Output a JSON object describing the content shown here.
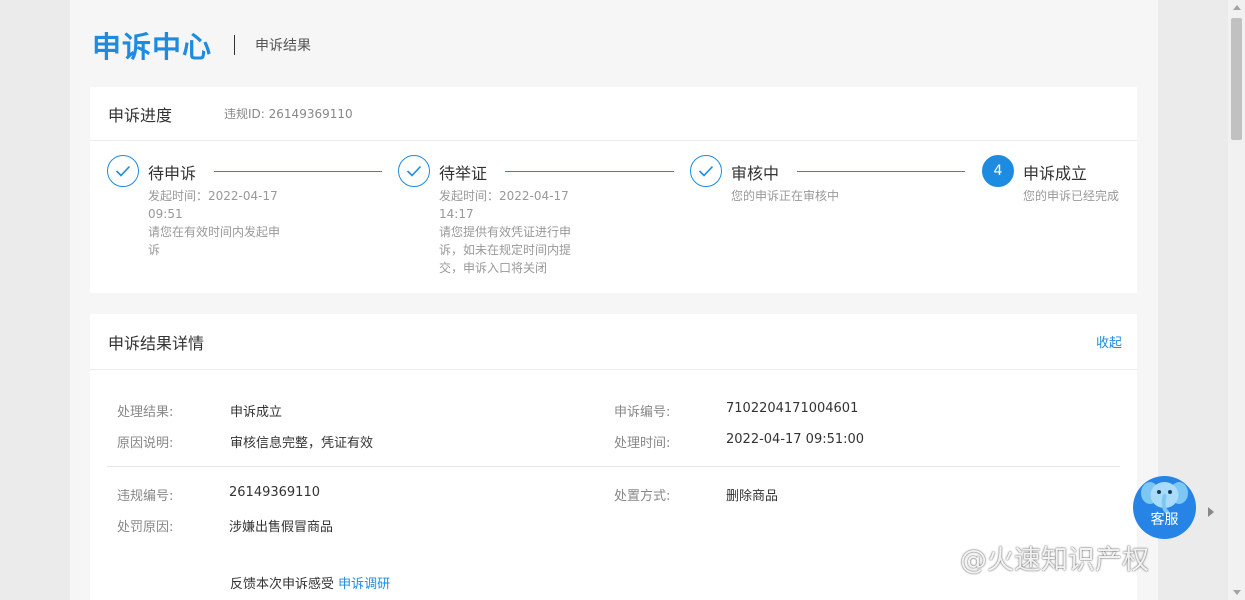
{
  "header": {
    "brand": "申诉中心",
    "subtitle": "申诉结果"
  },
  "progress": {
    "title": "申诉进度",
    "violation_id": "违规ID: 26149369110",
    "steps": [
      {
        "title": "待申诉",
        "desc": [
          "发起时间：2022-04-17",
          "09:51",
          "请您在有效时间内发起申",
          "诉"
        ],
        "status": "done"
      },
      {
        "title": "待举证",
        "desc": [
          "发起时间：2022-04-17",
          "14:17",
          "请您提供有效凭证进行申",
          "诉，如未在规定时间内提",
          "交，申诉入口将关闭"
        ],
        "status": "done"
      },
      {
        "title": "审核中",
        "desc": [
          "您的申诉正在审核中"
        ],
        "status": "done"
      },
      {
        "title": "申诉成立",
        "desc": [
          "您的申诉已经完成"
        ],
        "status": "active",
        "number": "4"
      }
    ]
  },
  "detail": {
    "title": "申诉结果详情",
    "collapse_label": "收起",
    "fields": {
      "result": {
        "label": "处理结果:",
        "value": "申诉成立"
      },
      "appeal_no": {
        "label": "申诉编号:",
        "value": "7102204171004601"
      },
      "reason_desc": {
        "label": "原因说明:",
        "value": "审核信息完整，凭证有效"
      },
      "process_time": {
        "label": "处理时间:",
        "value": "2022-04-17 09:51:00"
      },
      "violation_no": {
        "label": "违规编号:",
        "value": "26149369110"
      },
      "disposal": {
        "label": "处置方式:",
        "value": "删除商品"
      },
      "penalty_reason": {
        "label": "处罚原因:",
        "value": "涉嫌出售假冒商品"
      }
    },
    "feedback_prefix": "反馈本次申诉感受",
    "feedback_link": "申诉调研"
  },
  "customer_service": {
    "label": "客服"
  },
  "watermark": {
    "text": "@火速知识产权"
  },
  "colors": {
    "accent": "#1d8ce0",
    "cs_button": "#2584e6"
  }
}
